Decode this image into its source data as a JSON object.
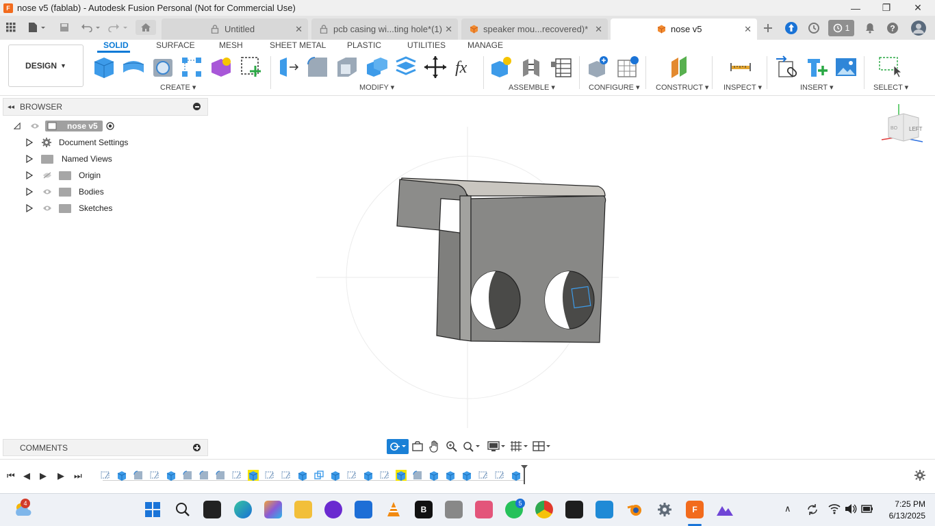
{
  "window": {
    "title": "nose v5 (fablab) - Autodesk Fusion Personal (Not for Commercial Use)",
    "app_icon": "F",
    "minimize": "—",
    "maximize": "❐",
    "close": "✕"
  },
  "tabs": [
    {
      "label": "Untitled",
      "icon": "lock-icon",
      "active": false
    },
    {
      "label": "pcb casing wi...ting hole*(1)",
      "icon": "lock-icon",
      "active": false
    },
    {
      "label": "speaker mou...recovered)*",
      "icon": "cube-icon",
      "active": false
    },
    {
      "label": "nose v5",
      "icon": "cube-icon",
      "active": true
    }
  ],
  "tab_close": "✕",
  "tabbar_right": {
    "job_count": "1"
  },
  "toolbar": {
    "workspace": "DESIGN",
    "ws_tabs": [
      "SOLID",
      "SURFACE",
      "MESH",
      "SHEET METAL",
      "PLASTIC",
      "UTILITIES",
      "MANAGE"
    ],
    "groups": [
      "CREATE",
      "MODIFY",
      "ASSEMBLE",
      "CONFIGURE",
      "CONSTRUCT",
      "INSPECT",
      "INSERT",
      "SELECT"
    ]
  },
  "browser": {
    "title": "BROWSER",
    "root": "nose v5",
    "items": [
      "Document Settings",
      "Named Views",
      "Origin",
      "Bodies",
      "Sketches"
    ]
  },
  "comments": {
    "title": "COMMENTS"
  },
  "viewcube": {
    "face": "LEFT",
    "back_face": "BO"
  },
  "taskbar": {
    "weather_badge": "4",
    "whatsapp_badge": "5",
    "time": "7:25 PM",
    "date": "6/13/2025"
  },
  "colors": {
    "accent": "#0a7ad6",
    "fusion_orange": "#f26b1d",
    "highlight": "#f5e400",
    "part_gray": "#8a8a88"
  }
}
